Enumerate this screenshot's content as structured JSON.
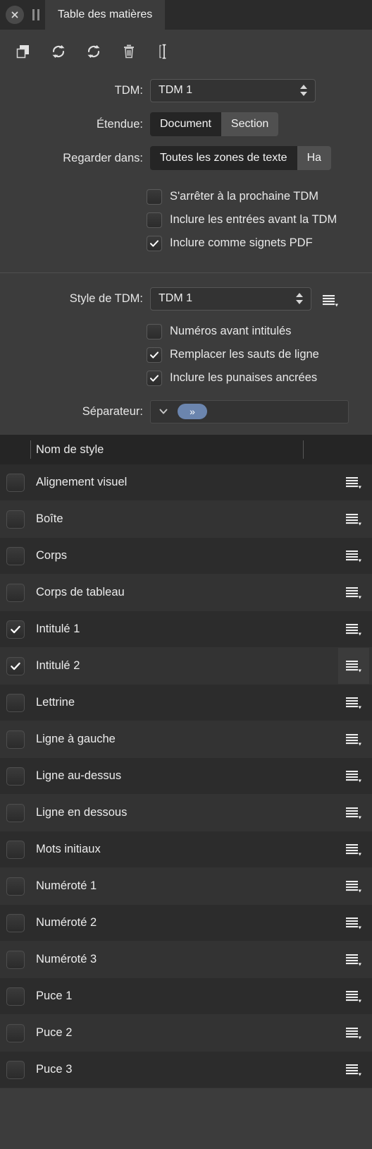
{
  "window": {
    "close_icon": "close-circle-icon",
    "grip_icon": "pause-grip-icon",
    "tab_label": "Table des matières"
  },
  "toolbar": {
    "buttons": [
      {
        "name": "duplicate-button",
        "icon": "duplicate-icon"
      },
      {
        "name": "update-button",
        "icon": "refresh-icon"
      },
      {
        "name": "refresh-button",
        "icon": "refresh-icon"
      },
      {
        "name": "delete-button",
        "icon": "trash-icon"
      },
      {
        "name": "text-cursor-button",
        "icon": "text-cursor-icon"
      }
    ]
  },
  "form": {
    "tdm": {
      "label": "TDM:",
      "value": "TDM 1"
    },
    "etendue": {
      "label": "Étendue:",
      "options": [
        "Document",
        "Section"
      ],
      "selected": "Document"
    },
    "regarder_dans": {
      "label": "Regarder dans:",
      "options": [
        "Toutes les zones de texte",
        "Ha"
      ],
      "selected": "Toutes les zones de texte"
    },
    "checkboxes": [
      {
        "label": "S'arrêter à la prochaine TDM",
        "checked": false
      },
      {
        "label": "Inclure les entrées avant la TDM",
        "checked": false
      },
      {
        "label": "Inclure comme signets PDF",
        "checked": true
      }
    ]
  },
  "style_section": {
    "style_tdm": {
      "label": "Style de TDM:",
      "value": "TDM 1",
      "menu_icon": "list-menu-icon"
    },
    "checkboxes": [
      {
        "label": "Numéros avant intitulés",
        "checked": false
      },
      {
        "label": "Remplacer les sauts de ligne",
        "checked": true
      },
      {
        "label": "Inclure les punaises ancrées",
        "checked": true
      }
    ],
    "separateur": {
      "label": "Séparateur:",
      "chevron_icon": "chevron-down-icon",
      "token": "»"
    }
  },
  "list": {
    "header": "Nom de style",
    "row_menu_icon": "list-menu-icon",
    "rows": [
      {
        "name": "Alignement visuel",
        "checked": false
      },
      {
        "name": "Boîte",
        "checked": false
      },
      {
        "name": "Corps",
        "checked": false
      },
      {
        "name": "Corps de tableau",
        "checked": false
      },
      {
        "name": "Intitulé 1",
        "checked": true
      },
      {
        "name": "Intitulé 2",
        "checked": true,
        "menu_hover": true
      },
      {
        "name": "Lettrine",
        "checked": false
      },
      {
        "name": "Ligne à gauche",
        "checked": false
      },
      {
        "name": "Ligne au-dessus",
        "checked": false
      },
      {
        "name": "Ligne en dessous",
        "checked": false
      },
      {
        "name": "Mots initiaux",
        "checked": false
      },
      {
        "name": "Numéroté 1",
        "checked": false
      },
      {
        "name": "Numéroté 2",
        "checked": false
      },
      {
        "name": "Numéroté 3",
        "checked": false
      },
      {
        "name": "Puce 1",
        "checked": false
      },
      {
        "name": "Puce 2",
        "checked": false
      },
      {
        "name": "Puce 3",
        "checked": false
      }
    ]
  },
  "colors": {
    "panel_bg": "#3c3c3c",
    "tabbar_bg": "#2b2b2b",
    "list_bg": "#2a2a2a",
    "accent_pill": "#6b85ae",
    "text": "#e8e8e8"
  }
}
